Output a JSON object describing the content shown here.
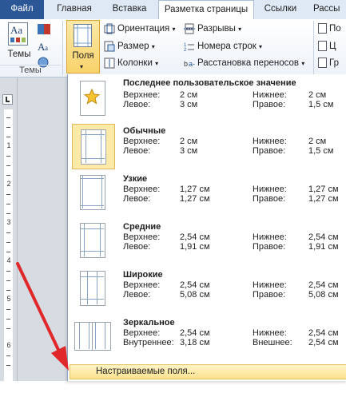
{
  "tabs": [
    "Файл",
    "Главная",
    "Вставка",
    "Разметка страницы",
    "Ссылки",
    "Рассы"
  ],
  "ribbon": {
    "themes_label": "Темы",
    "themes_group": "Темы",
    "margins_label": "Поля",
    "orientation": "Ориентация",
    "size": "Размер",
    "columns": "Колонки",
    "breaks": "Разрывы",
    "line_numbers": "Номера строк",
    "hyphenation": "Расстановка переносов",
    "right_partial_1": "По",
    "right_partial_2": "Ц",
    "right_partial_3": "Гр"
  },
  "ruler_numbers": [
    "1",
    "2",
    "3",
    "4",
    "5",
    "6"
  ],
  "margins_menu": {
    "items": [
      {
        "title": "Последнее пользовательское значение",
        "l1": "Верхнее:",
        "v1": "2 см",
        "r1": "Нижнее:",
        "w1": "2 см",
        "l2": "Левое:",
        "v2": "3 см",
        "r2": "Правое:",
        "w2": "1,5 см"
      },
      {
        "title": "Обычные",
        "l1": "Верхнее:",
        "v1": "2 см",
        "r1": "Нижнее:",
        "w1": "2 см",
        "l2": "Левое:",
        "v2": "3 см",
        "r2": "Правое:",
        "w2": "1,5 см"
      },
      {
        "title": "Узкие",
        "l1": "Верхнее:",
        "v1": "1,27 см",
        "r1": "Нижнее:",
        "w1": "1,27 см",
        "l2": "Левое:",
        "v2": "1,27 см",
        "r2": "Правое:",
        "w2": "1,27 см"
      },
      {
        "title": "Средние",
        "l1": "Верхнее:",
        "v1": "2,54 см",
        "r1": "Нижнее:",
        "w1": "2,54 см",
        "l2": "Левое:",
        "v2": "1,91 см",
        "r2": "Правое:",
        "w2": "1,91 см"
      },
      {
        "title": "Широкие",
        "l1": "Верхнее:",
        "v1": "2,54 см",
        "r1": "Нижнее:",
        "w1": "2,54 см",
        "l2": "Левое:",
        "v2": "5,08 см",
        "r2": "Правое:",
        "w2": "5,08 см"
      },
      {
        "title": "Зеркальное",
        "l1": "Верхнее:",
        "v1": "2,54 см",
        "r1": "Нижнее:",
        "w1": "2,54 см",
        "l2": "Внутреннее:",
        "v2": "3,18 см",
        "r2": "Внешнее:",
        "w2": "2,54 см"
      }
    ],
    "custom": "Настраиваемые поля..."
  },
  "colors": {
    "file_tab": "#2b5797",
    "selected": "#fde9a8",
    "arrow": "#e0282a"
  }
}
